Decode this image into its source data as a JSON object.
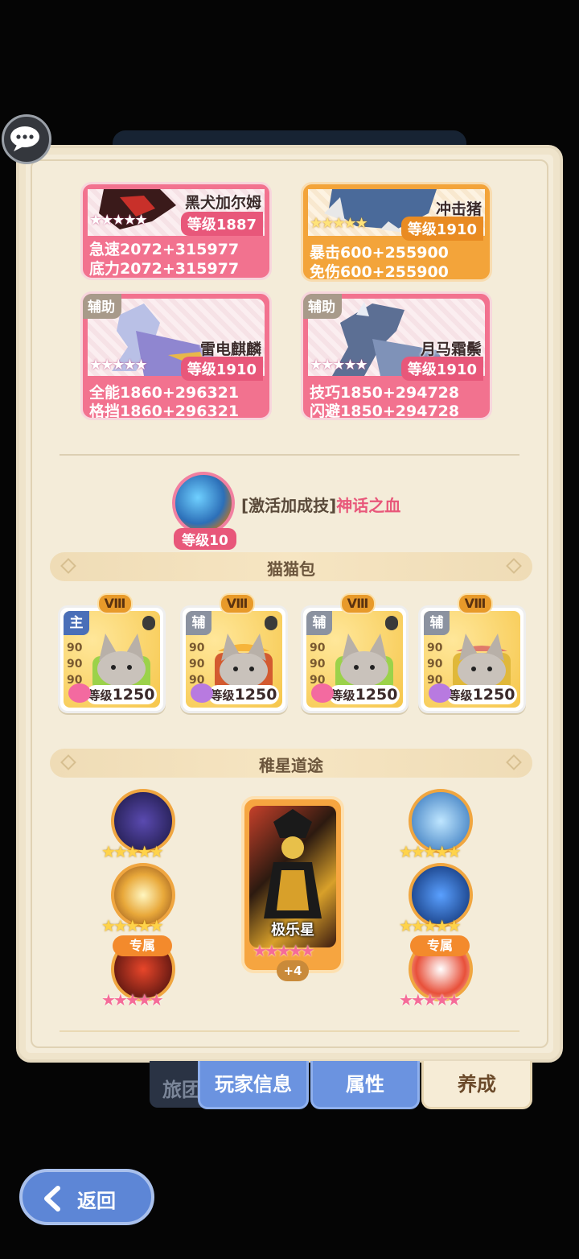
{
  "pets": [
    {
      "name": "黑犬加尔姆",
      "level": "等级1887",
      "stars": "★★★★★",
      "stats": [
        "急速2072+315977",
        "底力2072+315977"
      ],
      "tag": ""
    },
    {
      "name": "冲击猪",
      "level": "等级1910",
      "stars": "★★★★★",
      "stats": [
        "暴击600+255900",
        "免伤600+255900"
      ],
      "tag": ""
    },
    {
      "name": "雷电麒麟",
      "level": "等级1910",
      "stars": "★★★★★",
      "stats": [
        "全能1860+296321",
        "格挡1860+296321"
      ],
      "tag": "辅助"
    },
    {
      "name": "月马霜鬃",
      "level": "等级1910",
      "stars": "★★★★★",
      "stats": [
        "技巧1850+294728",
        "闪避1850+294728"
      ],
      "tag": "辅助"
    }
  ],
  "skill": {
    "level": "等级10",
    "bracket": "[激活加成技]",
    "name": "神话之血"
  },
  "sections": {
    "cat_bag": "猫猫包",
    "star_path": "稚星道途"
  },
  "bags": [
    {
      "rank": "Ⅷ",
      "role": "主",
      "nums": [
        "90",
        "90",
        "90"
      ],
      "level_label": "等级",
      "level": "1250"
    },
    {
      "rank": "Ⅷ",
      "role": "辅",
      "nums": [
        "90",
        "90",
        "90"
      ],
      "level_label": "等级",
      "level": "1250"
    },
    {
      "rank": "Ⅷ",
      "role": "辅",
      "nums": [
        "90",
        "90",
        "90"
      ],
      "level_label": "等级",
      "level": "1250"
    },
    {
      "rank": "Ⅷ",
      "role": "辅",
      "nums": [
        "90",
        "90",
        "90"
      ],
      "level_label": "等级",
      "level": "1250"
    }
  ],
  "star_path": {
    "tarot_name": "极乐星",
    "tarot_stars": "★★★★★",
    "tarot_plus": "+4",
    "orb_stars": "★★★★★",
    "exclusive": "专属"
  },
  "tabs": {
    "hidden": "旅团",
    "player_info": "玩家信息",
    "attributes": "属性",
    "cultivate": "养成"
  },
  "back_label": "返回",
  "colors": {
    "accent_pink": "#e8577a",
    "accent_blue": "#6b93e0",
    "panel_bg": "#f4ecd9"
  }
}
